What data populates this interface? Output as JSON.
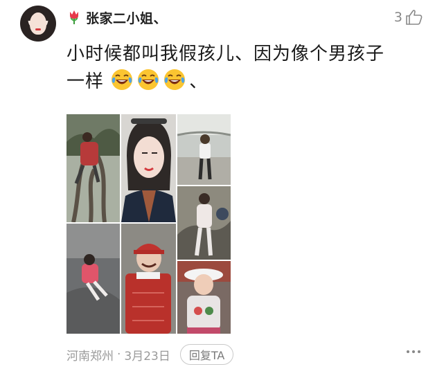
{
  "comment": {
    "username": "张家二小姐、",
    "likes": "3",
    "text_line1": "小时候都叫我假孩儿、因为像个男孩子",
    "text_line2_prefix": "一样",
    "text_line2_suffix": "、",
    "emojis": [
      "laughing-tears-icon",
      "laughing-tears-icon",
      "laughing-tears-icon"
    ]
  },
  "meta": {
    "location": "河南郑州",
    "separator": "·",
    "date": "3月23日",
    "reply_label": "回复TA"
  },
  "colors": {
    "username": "#1f1f1f",
    "meta_text": "#9a9a9a",
    "lips": "#d43b3f"
  }
}
